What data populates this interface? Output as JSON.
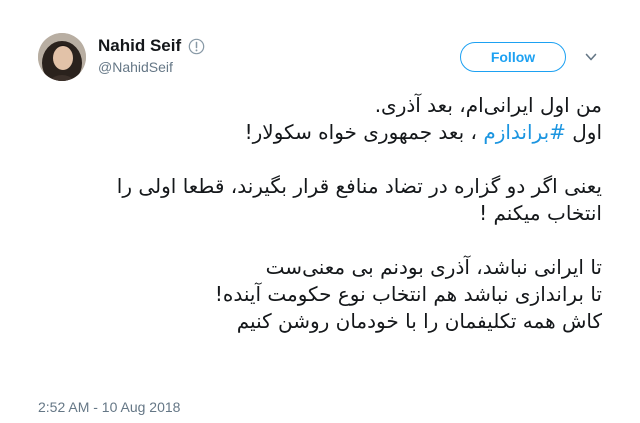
{
  "user": {
    "name": "Nahid Seif",
    "handle": "@NahidSeif"
  },
  "actions": {
    "follow_label": "Follow",
    "menu_icon": "chevron-down-icon"
  },
  "tweet": {
    "line1": "من اول ایرانی‌ام، بعد آذری.",
    "line2_prefix": "اول ",
    "line2_hashtag": "#براندازم",
    "line2_suffix": " ، بعد جمهوری خواه سکولار!",
    "line3": "یعنی اگر دو گزاره در تضاد منافع قرار بگیرند، قطعا اولی را",
    "line4": "انتخاب میکنم !",
    "line5": "تا ایرانی نباشد، آذری بودنم بی معنی‌ست",
    "line6": "تا براندازی نباشد هم انتخاب نوع حکومت آینده!",
    "line7": "کاش همه تکلیفمان را با خودمان روشن کنیم"
  },
  "meta": {
    "timestamp": "2:52 AM - 10 Aug 2018"
  },
  "colors": {
    "accent": "#1da1f2",
    "hashtag": "#1b95e0",
    "secondary_text": "#657786",
    "primary_text": "#14171a"
  }
}
